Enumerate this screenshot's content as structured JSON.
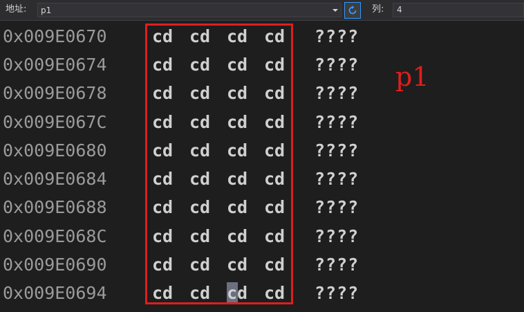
{
  "toolbar": {
    "address_label": "地址:",
    "address_value": "p1",
    "refresh_icon": "refresh-icon",
    "columns_label": "列:",
    "columns_value": "4"
  },
  "memory": {
    "rows": [
      {
        "address": "0x009E0670",
        "bytes": [
          "cd",
          "cd",
          "cd",
          "cd"
        ],
        "ascii": "????"
      },
      {
        "address": "0x009E0674",
        "bytes": [
          "cd",
          "cd",
          "cd",
          "cd"
        ],
        "ascii": "????"
      },
      {
        "address": "0x009E0678",
        "bytes": [
          "cd",
          "cd",
          "cd",
          "cd"
        ],
        "ascii": "????"
      },
      {
        "address": "0x009E067C",
        "bytes": [
          "cd",
          "cd",
          "cd",
          "cd"
        ],
        "ascii": "????"
      },
      {
        "address": "0x009E0680",
        "bytes": [
          "cd",
          "cd",
          "cd",
          "cd"
        ],
        "ascii": "????"
      },
      {
        "address": "0x009E0684",
        "bytes": [
          "cd",
          "cd",
          "cd",
          "cd"
        ],
        "ascii": "????"
      },
      {
        "address": "0x009E0688",
        "bytes": [
          "cd",
          "cd",
          "cd",
          "cd"
        ],
        "ascii": "????"
      },
      {
        "address": "0x009E068C",
        "bytes": [
          "cd",
          "cd",
          "cd",
          "cd"
        ],
        "ascii": "????"
      },
      {
        "address": "0x009E0690",
        "bytes": [
          "cd",
          "cd",
          "cd",
          "cd"
        ],
        "ascii": "????"
      },
      {
        "address": "0x009E0694",
        "bytes": [
          "cd",
          "cd",
          "cd",
          "cd"
        ],
        "ascii": "????"
      }
    ],
    "highlight": {
      "row": 9,
      "byte": 2
    }
  },
  "annotation": {
    "text": "p1",
    "color": "#e01e1e"
  },
  "colors": {
    "background": "#1e1e1e",
    "address_text": "#9b9b9b",
    "byte_text": "#d0d0d0",
    "selection": "#6b6f80",
    "accent": "#3399ff"
  }
}
